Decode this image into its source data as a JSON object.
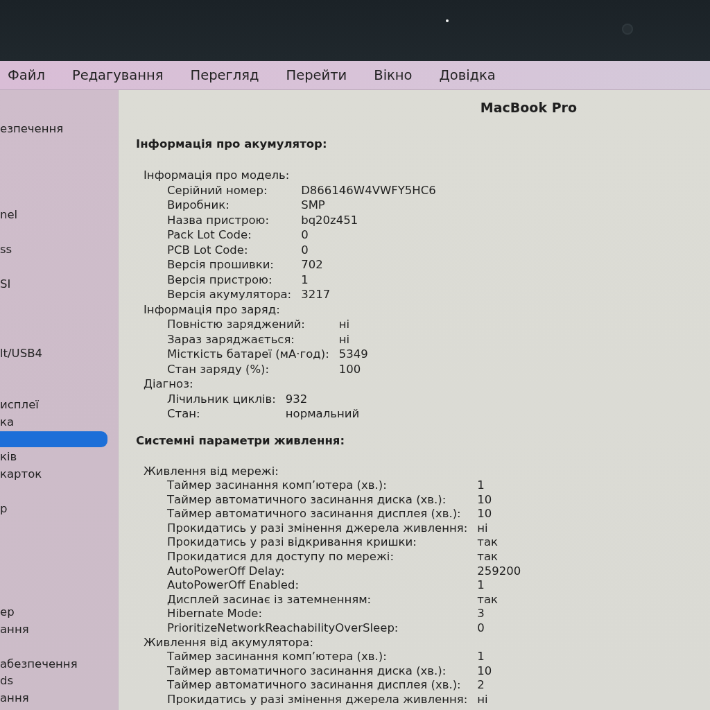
{
  "menu_bar": {
    "items": [
      "Файл",
      "Редагування",
      "Перегляд",
      "Перейти",
      "Вікно",
      "Довідка"
    ]
  },
  "sidebar": {
    "items": [
      {
        "label": "езпечення",
        "selected": false
      },
      {
        "label": "nel",
        "selected": false
      },
      {
        "label": "ss",
        "selected": false
      },
      {
        "label": "SI",
        "selected": false
      },
      {
        "label": "lt/USB4",
        "selected": false
      },
      {
        "label": "исплеї",
        "selected": false
      },
      {
        "label": "ка",
        "selected": false
      },
      {
        "selected": true
      },
      {
        "label": "ків",
        "selected": false
      },
      {
        "label": "карток",
        "selected": false
      },
      {
        "label": "р",
        "selected": false
      },
      {
        "label": "ер",
        "selected": false
      },
      {
        "label": "ання",
        "selected": false
      },
      {
        "label": "абезпечення",
        "selected": false
      },
      {
        "label": "ds",
        "selected": false
      },
      {
        "label": "ання",
        "selected": false
      }
    ]
  },
  "content": {
    "title": "MacBook Pro",
    "sections": [
      {
        "heading": "Інформація про акумулятор:",
        "groups": [
          {
            "title": "Інформація про модель:",
            "rows": [
              {
                "label": "Серійний номер:",
                "value": "D866146W4VWFY5HC6"
              },
              {
                "label": "Виробник:",
                "value": "SMP"
              },
              {
                "label": "Назва пристрою:",
                "value": "bq20z451"
              },
              {
                "label": "Pack Lot Code:",
                "value": "0"
              },
              {
                "label": "PCB Lot Code:",
                "value": "0"
              },
              {
                "label": "Версія прошивки:",
                "value": "702"
              },
              {
                "label": "Версія пристрою:",
                "value": "1"
              },
              {
                "label": "Версія акумулятора:",
                "value": "3217"
              }
            ]
          },
          {
            "title": "Інформація про заряд:",
            "rows": [
              {
                "label": "Повністю заряджений:",
                "value": "ні"
              },
              {
                "label": "Зараз заряджається:",
                "value": "ні"
              },
              {
                "label": "Місткість батареї (мА·год):",
                "value": "5349"
              },
              {
                "label": "Стан заряду (%):",
                "value": "100"
              }
            ]
          },
          {
            "title": "Діагноз:",
            "rows": [
              {
                "label": "Лічильник циклів:",
                "value": "932"
              },
              {
                "label": "Стан:",
                "value": "нормальний"
              }
            ]
          }
        ]
      },
      {
        "heading": "Системні параметри живлення:",
        "groups": [
          {
            "title": "Живлення від мережі:",
            "rows": [
              {
                "label": "Таймер засинання комп’ютера (хв.):",
                "value": "1"
              },
              {
                "label": "Таймер автоматичного засинання диска (хв.):",
                "value": "10"
              },
              {
                "label": "Таймер автоматичного засинання дисплея (хв.):",
                "value": "10"
              },
              {
                "label": "Прокидатись у разі змінення джерела живлення:",
                "value": "ні"
              },
              {
                "label": "Прокидатись у разі відкривання кришки:",
                "value": "так"
              },
              {
                "label": "Прокидатися для доступу по мережі:",
                "value": "так"
              },
              {
                "label": "AutoPowerOff Delay:",
                "value": "259200"
              },
              {
                "label": "AutoPowerOff Enabled:",
                "value": "1"
              },
              {
                "label": "Дисплей засинає із затемненням:",
                "value": "так"
              },
              {
                "label": "Hibernate Mode:",
                "value": "3"
              },
              {
                "label": "PrioritizeNetworkReachabilityOverSleep:",
                "value": "0"
              }
            ]
          },
          {
            "title": "Живлення від акумулятора:",
            "rows": [
              {
                "label": "Таймер засинання комп’ютера (хв.):",
                "value": "1"
              },
              {
                "label": "Таймер автоматичного засинання диска (хв.):",
                "value": "10"
              },
              {
                "label": "Таймер автоматичного засинання дисплея (хв.):",
                "value": "2"
              },
              {
                "label": "Прокидатись у разі змінення джерела живлення:",
                "value": "ні"
              }
            ]
          }
        ]
      }
    ]
  }
}
